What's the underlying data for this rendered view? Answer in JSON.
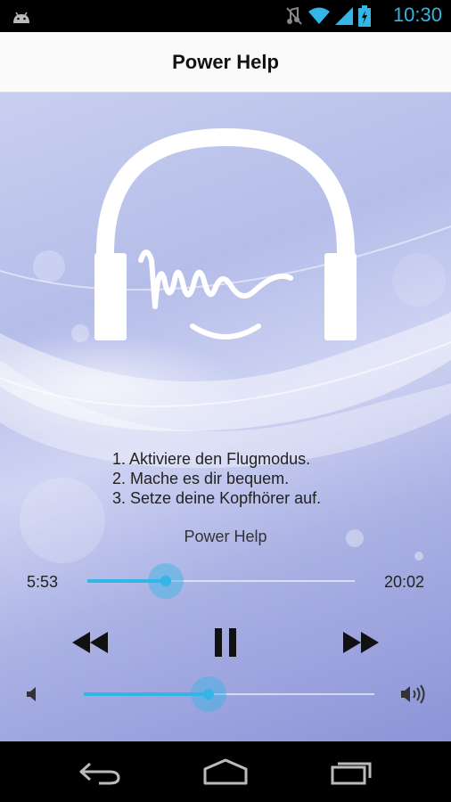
{
  "status_bar": {
    "time": "10:30",
    "icons": [
      "android-icon",
      "mute-icon",
      "wifi-icon",
      "signal-icon",
      "battery-charging-icon"
    ]
  },
  "action_bar": {
    "title": "Power Help"
  },
  "player": {
    "instructions": [
      "1. Aktiviere den Flugmodus.",
      "2. Mache es dir bequem.",
      "3. Setze deine Kopfhörer auf."
    ],
    "track_name": "Power Help",
    "elapsed": "5:53",
    "total": "20:02",
    "progress_fraction": 0.294,
    "volume_fraction": 0.43,
    "controls": [
      "rewind-icon",
      "pause-icon",
      "fast-forward-icon"
    ]
  },
  "nav_bar": {
    "buttons": [
      "back-icon",
      "home-icon",
      "recents-icon"
    ]
  },
  "colors": {
    "accent": "#33b5e5",
    "background_top": "#c9cff0",
    "background_bottom": "#8d94d8"
  }
}
